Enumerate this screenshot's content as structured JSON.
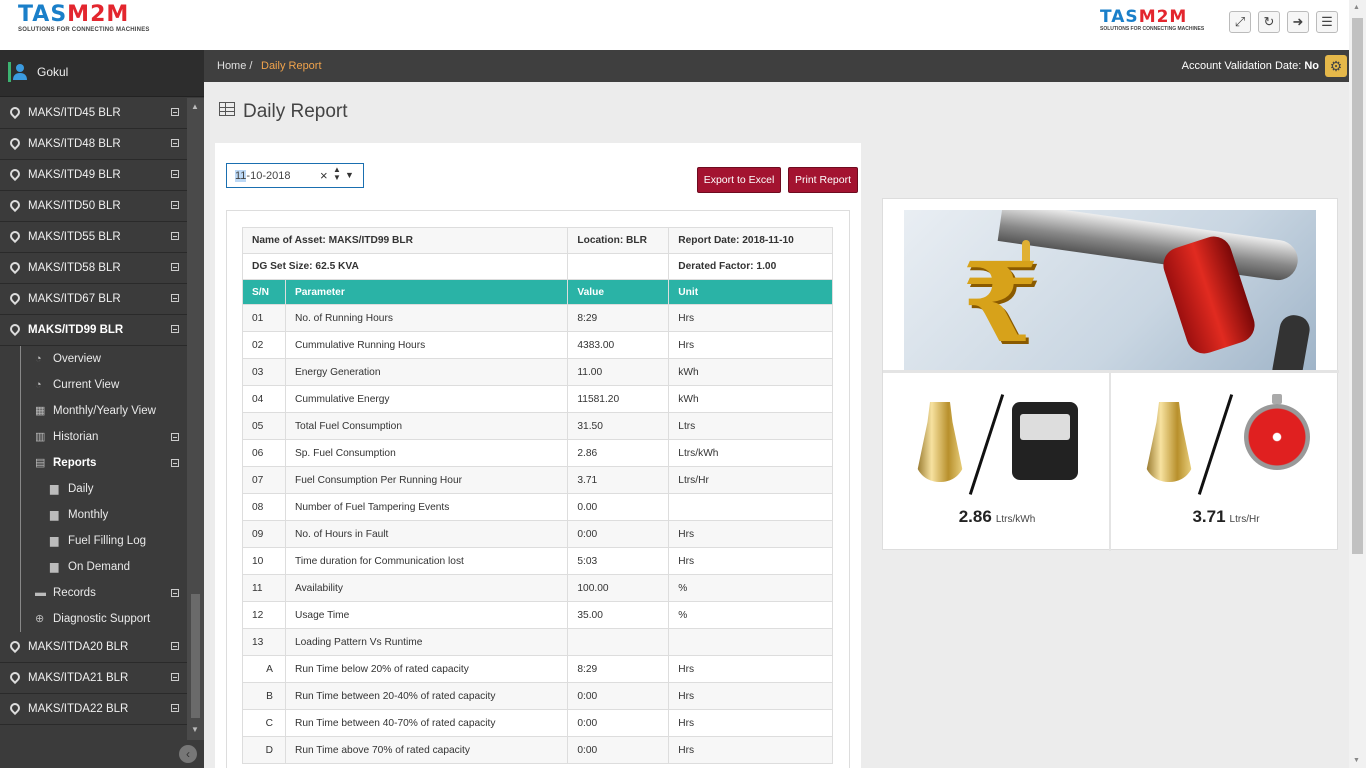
{
  "brand": {
    "name_a": "TAS",
    "name_b": "M2M",
    "tagline": "SOLUTIONS FOR CONNECTING MACHINES"
  },
  "user": {
    "name": "Gokul"
  },
  "sidebar": {
    "assets_top": [
      {
        "label": "MAKS/ITD45 BLR"
      },
      {
        "label": "MAKS/ITD48 BLR"
      },
      {
        "label": "MAKS/ITD49 BLR"
      },
      {
        "label": "MAKS/ITD50 BLR"
      },
      {
        "label": "MAKS/ITD55 BLR"
      },
      {
        "label": "MAKS/ITD58 BLR"
      },
      {
        "label": "MAKS/ITD67 BLR"
      },
      {
        "label": "MAKS/ITD99 BLR"
      }
    ],
    "submenu": {
      "overview": "Overview",
      "current_view": "Current View",
      "monthly_yearly": "Monthly/Yearly View",
      "historian": "Historian",
      "reports": "Reports",
      "daily": "Daily",
      "monthly": "Monthly",
      "fuel_filling_log": "Fuel Filling Log",
      "on_demand": "On Demand",
      "records": "Records",
      "diagnostic_support": "Diagnostic Support"
    },
    "assets_bottom": [
      {
        "label": "MAKS/ITDA20 BLR"
      },
      {
        "label": "MAKS/ITDA21 BLR"
      },
      {
        "label": "MAKS/ITDA22 BLR"
      }
    ]
  },
  "breadcrumb": {
    "home": "Home /",
    "current": "Daily Report"
  },
  "account": {
    "label": "Account Validation Date:",
    "value": "No"
  },
  "page": {
    "title": "Daily Report"
  },
  "controls": {
    "date_selected_part": "11",
    "date_rest": "-10-2018",
    "export_label": "Export to Excel",
    "print_label": "Print Report"
  },
  "report": {
    "asset": "Name of Asset: MAKS/ITD99 BLR",
    "location": "Location: BLR",
    "report_date": "Report Date: 2018-11-10",
    "dg_size": "DG Set Size: 62.5 KVA",
    "derated": "Derated Factor: 1.00",
    "headers": [
      "S/N",
      "Parameter",
      "Value",
      "Unit"
    ],
    "rows": [
      {
        "sn": "01",
        "param": "No. of Running Hours",
        "value": "8:29",
        "unit": "Hrs"
      },
      {
        "sn": "02",
        "param": "Cummulative Running Hours",
        "value": "4383.00",
        "unit": "Hrs"
      },
      {
        "sn": "03",
        "param": "Energy Generation",
        "value": "11.00",
        "unit": "kWh"
      },
      {
        "sn": "04",
        "param": "Cummulative Energy",
        "value": "11581.20",
        "unit": "kWh"
      },
      {
        "sn": "05",
        "param": "Total Fuel Consumption",
        "value": "31.50",
        "unit": "Ltrs"
      },
      {
        "sn": "06",
        "param": "Sp. Fuel Consumption",
        "value": "2.86",
        "unit": "Ltrs/kWh"
      },
      {
        "sn": "07",
        "param": "Fuel Consumption Per Running Hour",
        "value": "3.71",
        "unit": "Ltrs/Hr"
      },
      {
        "sn": "08",
        "param": "Number of Fuel Tampering Events",
        "value": "0.00",
        "unit": ""
      },
      {
        "sn": "09",
        "param": "No. of Hours in Fault",
        "value": "0:00",
        "unit": "Hrs"
      },
      {
        "sn": "10",
        "param": "Time duration for Communication lost",
        "value": "5:03",
        "unit": "Hrs"
      },
      {
        "sn": "11",
        "param": "Availability",
        "value": "100.00",
        "unit": "%"
      },
      {
        "sn": "12",
        "param": "Usage Time",
        "value": "35.00",
        "unit": "%"
      },
      {
        "sn": "13",
        "param": "Loading Pattern Vs Runtime",
        "value": "",
        "unit": ""
      },
      {
        "sn": "A",
        "param": "Run Time below 20% of rated capacity",
        "value": "8:29",
        "unit": "Hrs"
      },
      {
        "sn": "B",
        "param": "Run Time between 20-40% of rated capacity",
        "value": "0:00",
        "unit": "Hrs"
      },
      {
        "sn": "C",
        "param": "Run Time between 40-70% of rated capacity",
        "value": "0:00",
        "unit": "Hrs"
      },
      {
        "sn": "D",
        "param": "Run Time above 70% of rated capacity",
        "value": "0:00",
        "unit": "Hrs"
      }
    ]
  },
  "kpis": [
    {
      "value": "2.86",
      "unit": "Ltrs/kWh",
      "icon": "fuel-per-energy-icon"
    },
    {
      "value": "3.71",
      "unit": "Ltrs/Hr",
      "icon": "fuel-per-hour-icon"
    }
  ],
  "colors": {
    "table_header": "#2ab3a6",
    "button": "#a31330",
    "breadcrumb_current": "#f0a34c",
    "settings": "#e5b84a"
  }
}
